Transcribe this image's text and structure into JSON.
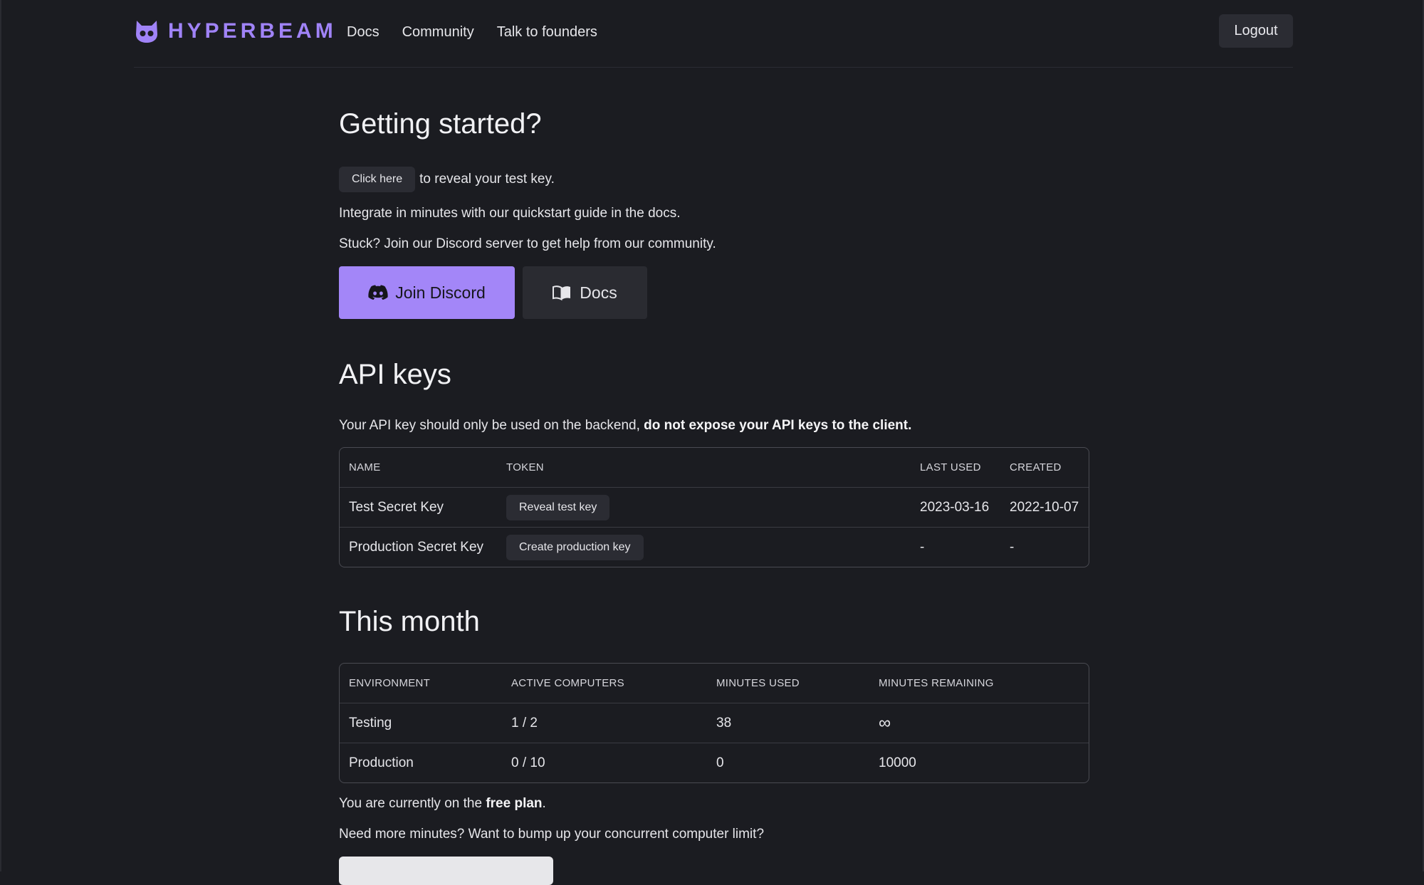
{
  "header": {
    "brand": "HYPERBEAM",
    "nav": [
      "Docs",
      "Community",
      "Talk to founders"
    ],
    "logout_label": "Logout"
  },
  "getting_started": {
    "title": "Getting started?",
    "reveal_button": "Click here",
    "reveal_text": "to reveal your test key.",
    "quickstart_text": "Integrate in minutes with our quickstart guide in the docs.",
    "discord_text": "Stuck? Join our Discord server to get help from our community.",
    "discord_button": "Join Discord",
    "docs_button": "Docs"
  },
  "api_keys": {
    "title": "API keys",
    "note_prefix": "Your API key should only be used on the backend,",
    "note_bold": "do not expose your API keys to the client.",
    "columns": [
      "NAME",
      "TOKEN",
      "LAST USED",
      "CREATED"
    ],
    "rows": [
      {
        "name": "Test Secret Key",
        "token_button": "Reveal test key",
        "last_used": "2023-03-16",
        "created": "2022-10-07"
      },
      {
        "name": "Production Secret Key",
        "token_button": "Create production key",
        "last_used": "-",
        "created": "-"
      }
    ]
  },
  "this_month": {
    "title": "This month",
    "columns": [
      "ENVIRONMENT",
      "ACTIVE COMPUTERS",
      "MINUTES USED",
      "MINUTES REMAINING"
    ],
    "rows": [
      {
        "environment": "Testing",
        "active": "1 / 2",
        "used": "38",
        "remaining": "∞"
      },
      {
        "environment": "Production",
        "active": "0 / 10",
        "used": "0",
        "remaining": "10000"
      }
    ],
    "plan_prefix": "You are currently on the",
    "plan_name": "free plan",
    "plan_suffix": ".",
    "upsell_text": "Need more minutes? Want to bump up your concurrent computer limit?"
  },
  "colors": {
    "accent": "#a386f8",
    "background": "#1b1c21",
    "surface": "#2b2c33"
  }
}
